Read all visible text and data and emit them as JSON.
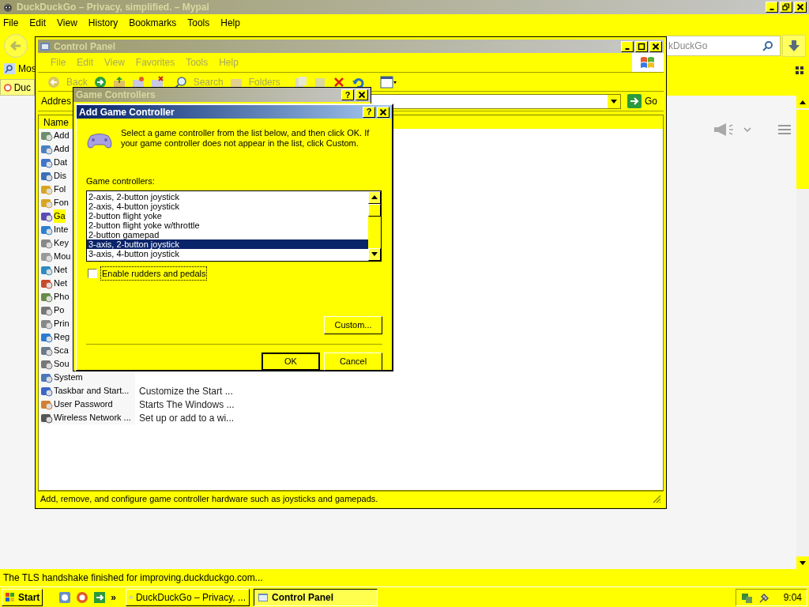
{
  "browser": {
    "title": "DuckDuckGo – Privacy, simplified. – Mypal",
    "menu": [
      "File",
      "Edit",
      "View",
      "History",
      "Bookmarks",
      "Tools",
      "Help"
    ],
    "search_value": "kDuckGo",
    "bookmark": "Mos",
    "tab": "Duc",
    "status": "The TLS handshake finished for improving.duckduckgo.com..."
  },
  "control_panel": {
    "title": "Control Panel",
    "menu_disabled": true,
    "menu": [
      "File",
      "Edit",
      "View",
      "Favorites",
      "Tools",
      "Help"
    ],
    "toolbar": {
      "back": "Back",
      "search": "Search",
      "folders": "Folders"
    },
    "address_label": "Addres",
    "go": "Go",
    "column": "Name",
    "items": [
      {
        "name": "Add",
        "selected": false
      },
      {
        "name": "Add",
        "selected": false
      },
      {
        "name": "Dat",
        "selected": false
      },
      {
        "name": "Dis",
        "selected": false
      },
      {
        "name": "Fol",
        "selected": false
      },
      {
        "name": "Fon",
        "selected": false
      },
      {
        "name": "Ga",
        "selected": true
      },
      {
        "name": "Inte",
        "selected": false
      },
      {
        "name": "Key",
        "selected": false
      },
      {
        "name": "Mou",
        "selected": false
      },
      {
        "name": "Net",
        "selected": false
      },
      {
        "name": "Net",
        "selected": false
      },
      {
        "name": "Pho",
        "selected": false
      },
      {
        "name": "Po",
        "selected": false
      },
      {
        "name": "Prin",
        "selected": false
      },
      {
        "name": "Reg",
        "selected": false
      },
      {
        "name": "Sca",
        "selected": false
      },
      {
        "name": "Sou",
        "selected": false
      },
      {
        "name": "System",
        "selected": false
      },
      {
        "name": "Taskbar and Start...",
        "comment": "Customize the Start ...",
        "selected": false
      },
      {
        "name": "User Password",
        "comment": "Starts The Windows ...",
        "selected": false
      },
      {
        "name": "Wireless Network ...",
        "comment": "Set up or add to a wi...",
        "selected": false
      }
    ],
    "status": "Add, remove, and configure game controller hardware such as joysticks and gamepads."
  },
  "game_controllers": {
    "title": "Game Controllers",
    "help": "?"
  },
  "dialog": {
    "title": "Add Game Controller",
    "help": "?",
    "message": "Select a game controller from the list below, and then click OK.  If your game controller does not appear in the list, click Custom.",
    "list_label": "Game controllers:",
    "controllers": [
      {
        "label": "2-axis, 2-button joystick",
        "selected": false
      },
      {
        "label": "2-axis, 4-button joystick",
        "selected": false
      },
      {
        "label": "2-button flight yoke",
        "selected": false
      },
      {
        "label": "2-button flight yoke w/throttle",
        "selected": false
      },
      {
        "label": "2-button gamepad",
        "selected": false
      },
      {
        "label": "3-axis, 2-button joystick",
        "selected": true
      },
      {
        "label": "3-axis, 4-button joystick",
        "selected": false
      }
    ],
    "checkbox": {
      "label": "Enable rudders and pedals",
      "checked": false
    },
    "custom": "Custom...",
    "ok": "OK",
    "cancel": "Cancel"
  },
  "taskbar": {
    "start": "Start",
    "more": "»",
    "tasks": [
      {
        "label": "DuckDuckGo – Privacy, ...",
        "selected": false
      },
      {
        "label": "Control Panel",
        "selected": true
      }
    ],
    "time": "9:04"
  }
}
